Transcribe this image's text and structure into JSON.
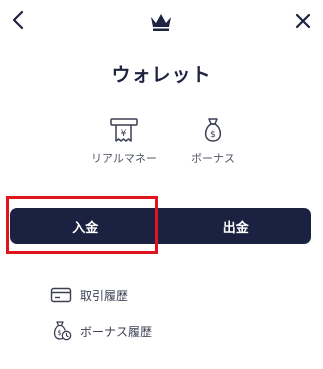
{
  "header": {
    "back_icon": "chevron-left-icon",
    "logo_icon": "crown-icon",
    "close_icon": "close-icon"
  },
  "title": "ウォレット",
  "balances": {
    "real": {
      "label": "リアルマネー",
      "icon": "receipt-icon"
    },
    "bonus": {
      "label": "ボーナス",
      "icon": "money-bag-icon"
    }
  },
  "tabs": {
    "deposit": "入金",
    "withdraw": "出金",
    "active": "deposit",
    "highlight_color": "#e0141c"
  },
  "menu": {
    "transaction_history": {
      "label": "取引履歴",
      "icon": "card-icon"
    },
    "bonus_history": {
      "label": "ボーナス履歴",
      "icon": "money-bag-clock-icon"
    }
  },
  "colors": {
    "primary": "#1b2241",
    "text_secondary": "#54586a"
  }
}
